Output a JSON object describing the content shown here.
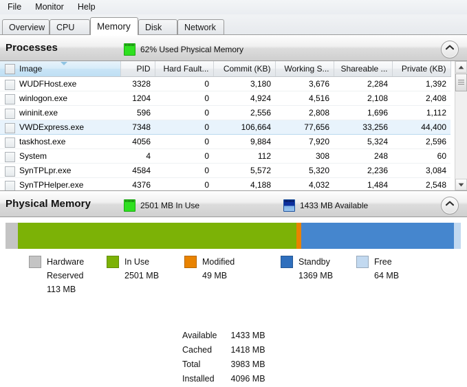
{
  "menu": {
    "items": [
      {
        "label": "File"
      },
      {
        "label": "Monitor"
      },
      {
        "label": "Help"
      }
    ]
  },
  "tabs": [
    {
      "label": "Overview",
      "active": false
    },
    {
      "label": "CPU",
      "active": false
    },
    {
      "label": "Memory",
      "active": true
    },
    {
      "label": "Disk",
      "active": false
    },
    {
      "label": "Network",
      "active": false
    }
  ],
  "processes_section": {
    "title": "Processes",
    "stat_label": "62% Used Physical Memory",
    "stat_icon": "memory-chip-green-icon",
    "collapse_icon": "chevron-up-icon",
    "columns": [
      "Image",
      "PID",
      "Hard Fault...",
      "Commit (KB)",
      "Working S...",
      "Shareable ...",
      "Private (KB)"
    ],
    "rows": [
      {
        "image": "WUDFHost.exe",
        "pid": "3328",
        "hard_faults": "0",
        "commit": "3,180",
        "working_set": "3,676",
        "shareable": "2,284",
        "private": "1,392",
        "selected": false
      },
      {
        "image": "winlogon.exe",
        "pid": "1204",
        "hard_faults": "0",
        "commit": "4,924",
        "working_set": "4,516",
        "shareable": "2,108",
        "private": "2,408",
        "selected": false
      },
      {
        "image": "wininit.exe",
        "pid": "596",
        "hard_faults": "0",
        "commit": "2,556",
        "working_set": "2,808",
        "shareable": "1,696",
        "private": "1,112",
        "selected": false
      },
      {
        "image": "VWDExpress.exe",
        "pid": "7348",
        "hard_faults": "0",
        "commit": "106,664",
        "working_set": "77,656",
        "shareable": "33,256",
        "private": "44,400",
        "selected": true
      },
      {
        "image": "taskhost.exe",
        "pid": "4056",
        "hard_faults": "0",
        "commit": "9,884",
        "working_set": "7,920",
        "shareable": "5,324",
        "private": "2,596",
        "selected": false
      },
      {
        "image": "System",
        "pid": "4",
        "hard_faults": "0",
        "commit": "112",
        "working_set": "308",
        "shareable": "248",
        "private": "60",
        "selected": false
      },
      {
        "image": "SynTPLpr.exe",
        "pid": "4584",
        "hard_faults": "0",
        "commit": "5,572",
        "working_set": "5,320",
        "shareable": "2,236",
        "private": "3,084",
        "selected": false
      },
      {
        "image": "SynTPHelper.exe",
        "pid": "4376",
        "hard_faults": "0",
        "commit": "4,188",
        "working_set": "4,032",
        "shareable": "1,484",
        "private": "2,548",
        "selected": false
      }
    ]
  },
  "physical_memory_section": {
    "title": "Physical Memory",
    "stat_in_use": "2501 MB In Use",
    "stat_available": "1433 MB Available",
    "in_use_icon": "memory-chip-green-icon",
    "available_icon": "memory-chip-blue-icon",
    "collapse_icon": "chevron-up-icon",
    "bar_segments": [
      {
        "name": "Hardware Reserved",
        "value_mb": 113,
        "color": "#c4c4c4",
        "width_pct": 2.76
      },
      {
        "name": "In Use",
        "value_mb": 2501,
        "color": "#7cb206",
        "width_pct": 61.07
      },
      {
        "name": "Modified",
        "value_mb": 49,
        "color": "#e98300",
        "width_pct": 1.2
      },
      {
        "name": "Standby",
        "value_mb": 1369,
        "color": "#4586ce",
        "width_pct": 33.42
      },
      {
        "name": "Free",
        "value_mb": 64,
        "color": "#c2d9f0",
        "width_pct": 1.56
      }
    ],
    "legend": [
      {
        "label_line1": "Hardware",
        "label_line2": "Reserved",
        "value": "113 MB",
        "color": "#c4c4c4",
        "swatch_icon": "legend-swatch-hardware-reserved"
      },
      {
        "label_line1": "In Use",
        "label_line2": "",
        "value": "2501 MB",
        "color": "#7cb206",
        "swatch_icon": "legend-swatch-in-use"
      },
      {
        "label_line1": "Modified",
        "label_line2": "",
        "value": "49 MB",
        "color": "#e98300",
        "swatch_icon": "legend-swatch-modified"
      },
      {
        "label_line1": "Standby",
        "label_line2": "",
        "value": "1369 MB",
        "color": "#2f6fbd",
        "swatch_icon": "legend-swatch-standby"
      },
      {
        "label_line1": "Free",
        "label_line2": "",
        "value": "64 MB",
        "color": "#c2d9f0",
        "swatch_icon": "legend-swatch-free"
      }
    ],
    "summary": [
      {
        "key": "Available",
        "value": "1433 MB"
      },
      {
        "key": "Cached",
        "value": "1418 MB"
      },
      {
        "key": "Total",
        "value": "3983 MB"
      },
      {
        "key": "Installed",
        "value": "4096 MB"
      }
    ]
  }
}
